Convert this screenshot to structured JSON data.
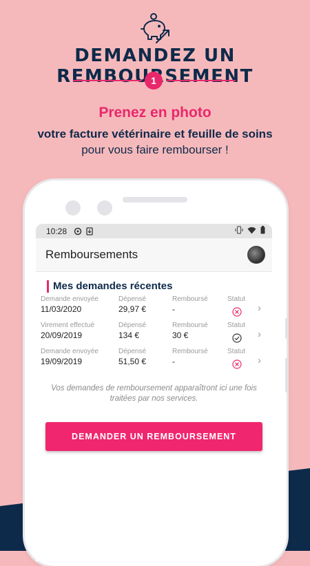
{
  "header": {
    "icon": "piggy-bank-icon",
    "title": "DEMANDEZ UN REMBOURSEMENT",
    "step": "1"
  },
  "tagline": {
    "line1": "Prenez en photo",
    "line2": "votre facture vétérinaire et feuille de soins",
    "line3": "pour vous faire rembourser !"
  },
  "colors": {
    "background": "#f6b9bb",
    "navy": "#0e2a4a",
    "accent": "#e8286b",
    "cta": "#f0266e"
  },
  "status_bar": {
    "time": "10:28"
  },
  "app": {
    "title": "Remboursements",
    "section_title": "Mes demandes récentes",
    "rows": [
      {
        "date_label": "Demande envoyée",
        "date": "11/03/2020",
        "spent_label": "Dépensé",
        "spent": "29,97 €",
        "refund_label": "Remboursé",
        "refund": "-",
        "status_label": "Statut",
        "status": "rejected"
      },
      {
        "date_label": "Virement effectué",
        "date": "20/09/2019",
        "spent_label": "Dépensé",
        "spent": "134 €",
        "refund_label": "Remboursé",
        "refund": "30 €",
        "status_label": "Statut",
        "status": "approved"
      },
      {
        "date_label": "Demande envoyée",
        "date": "19/09/2019",
        "spent_label": "Dépensé",
        "spent": "51,50 €",
        "refund_label": "Remboursé",
        "refund": "-",
        "status_label": "Statut",
        "status": "rejected"
      }
    ],
    "note": "Vos demandes de remboursement apparaîtront ici une fois traitées par nos services.",
    "cta": "DEMANDER UN REMBOURSEMENT"
  }
}
